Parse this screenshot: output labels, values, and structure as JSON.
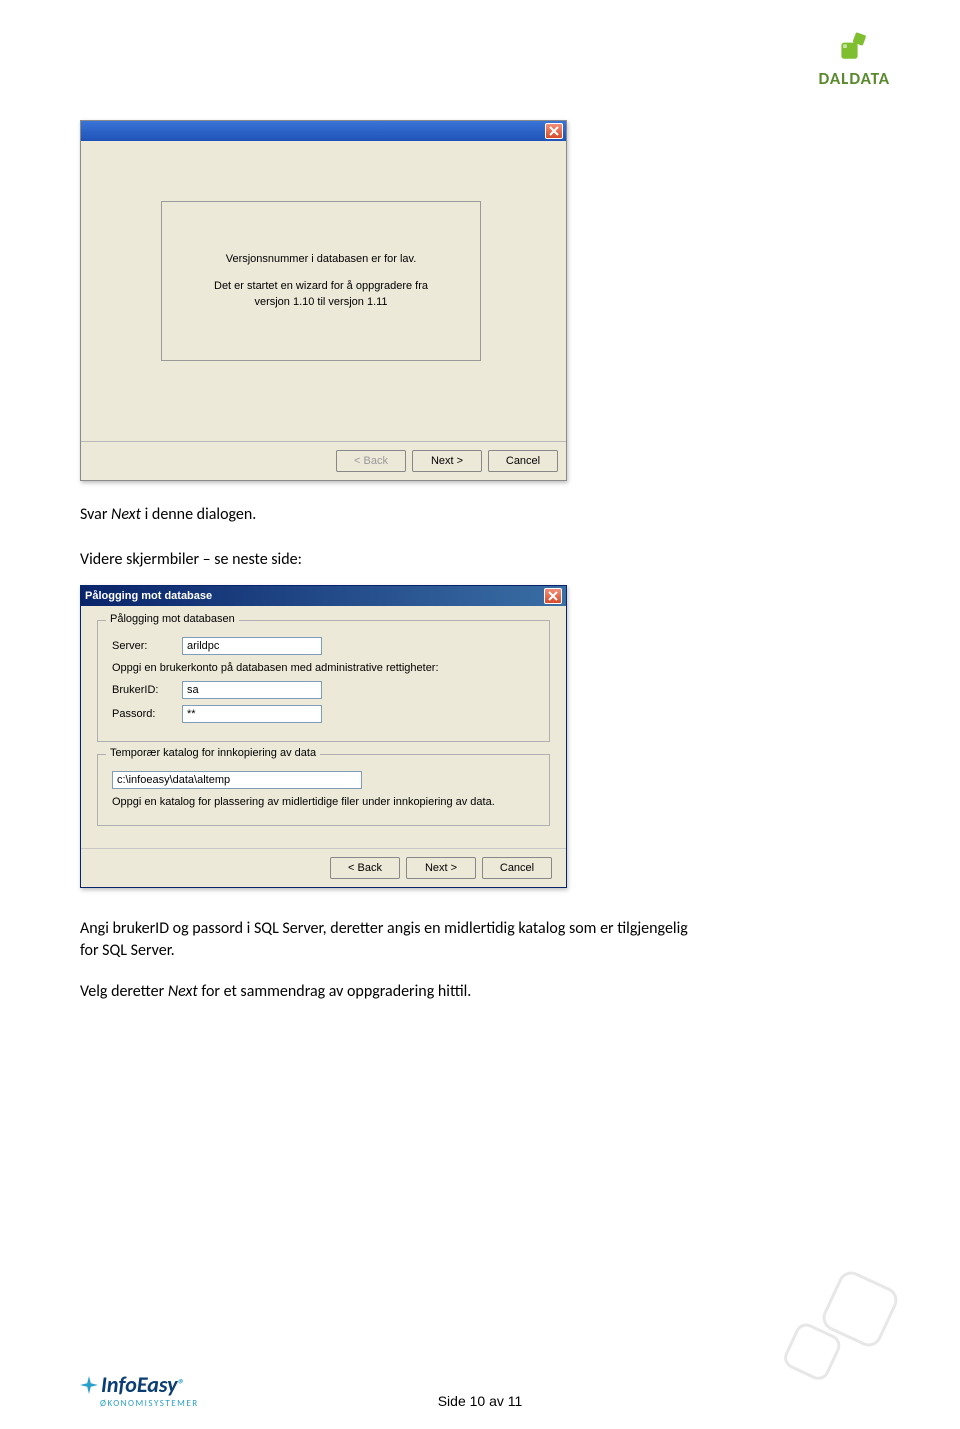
{
  "logo": {
    "daldata": "DALDATA",
    "infoeasy_main": "InfoEasy",
    "infoeasy_sub": "ØKONOMISYSTEMER"
  },
  "dialog1": {
    "msg_line1": "Versjonsnummer i databasen er for lav.",
    "msg_line2": "Det er startet en wizard for å oppgradere fra",
    "msg_line3": "versjon 1.10 til versjon 1.11",
    "btn_back": "< Back",
    "btn_next": "Next >",
    "btn_cancel": "Cancel"
  },
  "para1_a": "Svar ",
  "para1_em": "Next",
  "para1_b": " i denne dialogen.",
  "para2": "Videre skjermbiler – se neste side:",
  "dialog2": {
    "title": "Pålogging mot database",
    "group1_title": "Pålogging mot databasen",
    "lbl_server": "Server:",
    "val_server": "arildpc",
    "desc1": "Oppgi en brukerkonto på databasen med administrative rettigheter:",
    "lbl_brukerid": "BrukerID:",
    "val_brukerid": "sa",
    "lbl_passord": "Passord:",
    "val_passord": "**",
    "group2_title": "Temporær katalog for innkopiering av data",
    "val_path": "c:\\infoeasy\\data\\altemp",
    "desc2": "Oppgi en katalog for plassering av midlertidige filer under innkopiering av data.",
    "btn_back": "< Back",
    "btn_next": "Next >",
    "btn_cancel": "Cancel"
  },
  "para3": "Angi brukerID og passord i SQL Server, deretter angis en midlertidig katalog som er tilgjengelig for SQL Server.",
  "para4_a": "Velg deretter ",
  "para4_em": "Next",
  "para4_b": " for et sammendrag av oppgradering hittil.",
  "footer_page": "Side 10 av 11"
}
